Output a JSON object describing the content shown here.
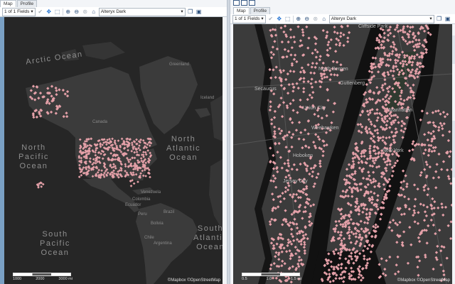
{
  "left": {
    "tabs": [
      "Map",
      "Profile"
    ],
    "toolbar": {
      "fields": "1 of 1 Fields",
      "basemap": "Alteryx Dark"
    },
    "labels": {
      "arctic": "Arctic Ocean",
      "north_pacific_1": "North",
      "north_pacific_2": "Pacific",
      "north_pacific_3": "Ocean",
      "north_atlantic_1": "North",
      "north_atlantic_2": "Atlantic",
      "north_atlantic_3": "Ocean",
      "south_pacific_1": "South",
      "south_pacific_2": "Pacific",
      "south_pacific_3": "Ocean",
      "south_atlantic_1": "South",
      "south_atlantic_2": "Atlantic",
      "south_atlantic_3": "Ocean",
      "greenland": "Greenland",
      "iceland": "Iceland",
      "canada": "Canada",
      "venezuela": "Venezuela",
      "colombia": "Colombia",
      "ecuador": "Ecuador",
      "brazil": "Brazil",
      "peru": "Peru",
      "bolivia": "Bolivia",
      "chile": "Chile",
      "argentina": "Argentina"
    },
    "scale": [
      "1000",
      "2000",
      "3000 mi"
    ],
    "attribution": "©Mapbox ©OpenStreetMap"
  },
  "right": {
    "tabs": [
      "Map",
      "Profile"
    ],
    "toolbar": {
      "fields": "1 of 1 Fields",
      "basemap": "Alteryx Dark"
    },
    "labels": {
      "secaucus": "Secaucus",
      "union_city": "Union City",
      "weehawken": "Weehawken",
      "hoboken": "Hoboken",
      "manhattan": "Manhattan",
      "cliffside_park": "Cliffside Park",
      "guttenberg": "Guttenberg",
      "north_bergen": "North Bergen",
      "jersey_city": "Jersey City",
      "new_york": "New York"
    },
    "scale": [
      "0.5",
      "1.0",
      "1.5 mi"
    ],
    "attribution": "©Mapbox ©OpenStreetMap"
  },
  "colors": {
    "point": "#e4a0a8",
    "map_bg": "#262626",
    "land": "#3b3b3b",
    "water": "#111111",
    "accent": "#1d6fd1"
  },
  "icons": [
    "chevron-down-icon",
    "checkmark-icon",
    "pan-icon",
    "select-icon",
    "zoom-in-icon",
    "zoom-out-icon",
    "zoom-extent-icon",
    "home-icon",
    "copy-icon",
    "save-icon"
  ]
}
